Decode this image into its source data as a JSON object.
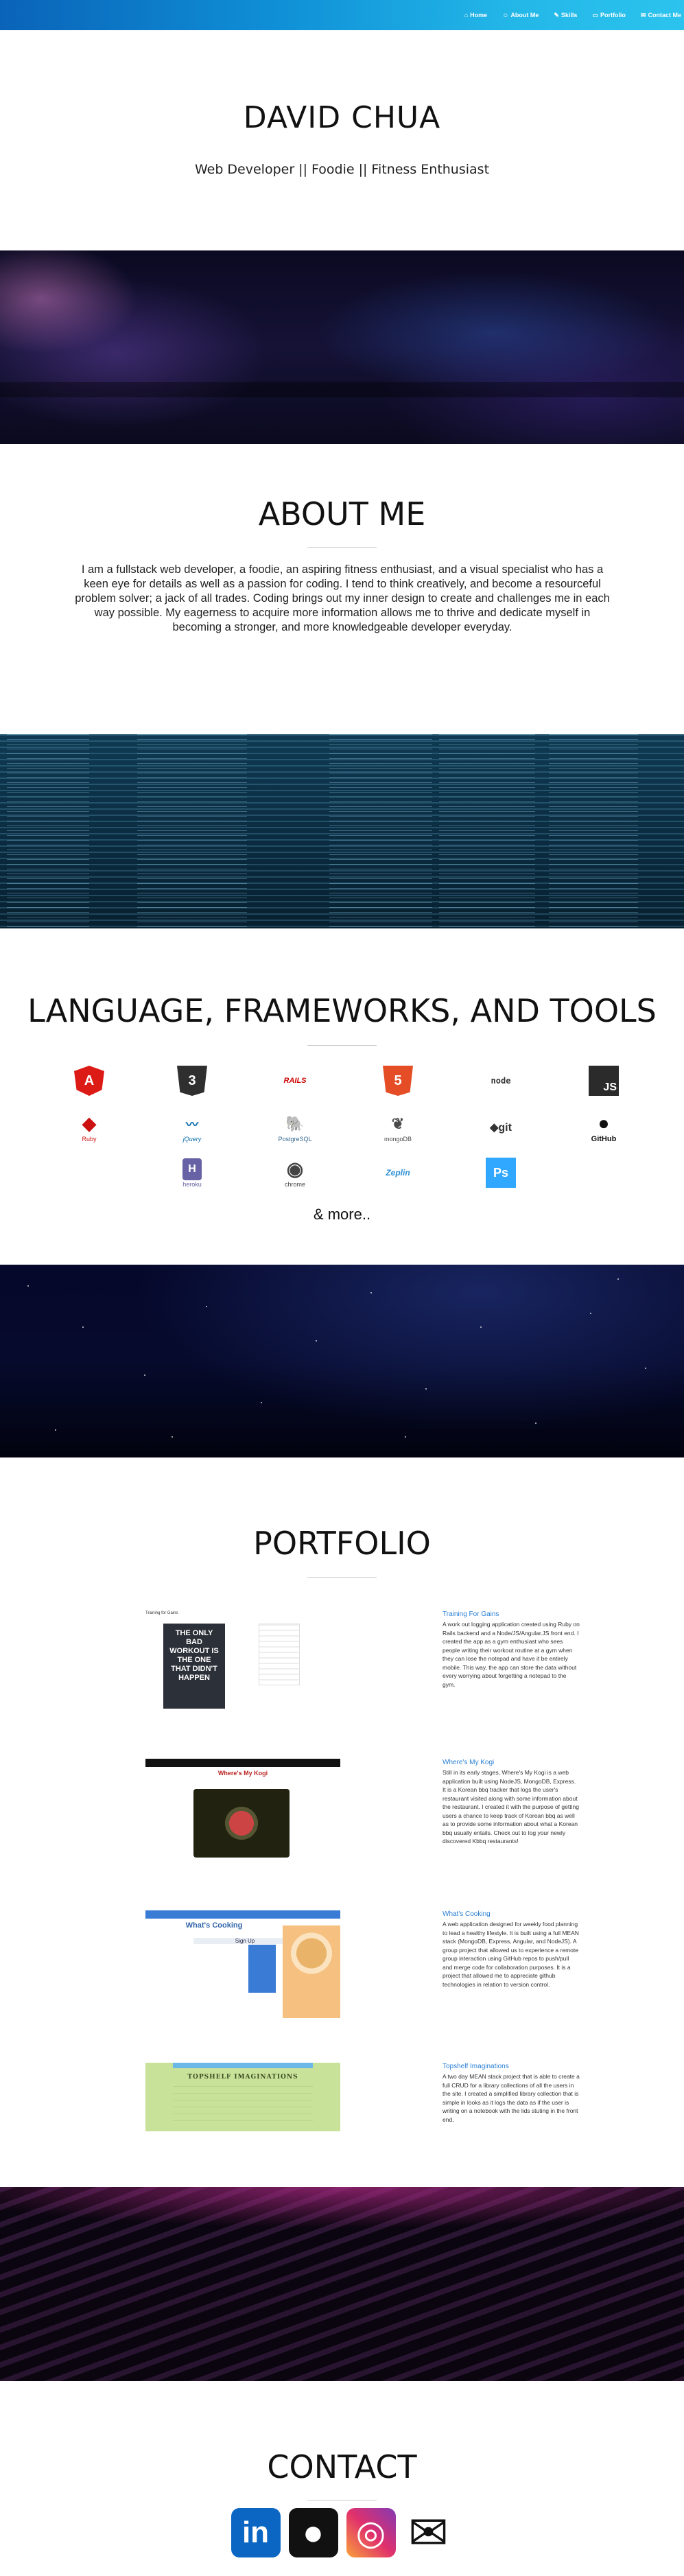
{
  "nav": {
    "items": [
      {
        "icon": "home-icon",
        "label": "Home"
      },
      {
        "icon": "user-icon",
        "label": "About Me"
      },
      {
        "icon": "wrench-icon",
        "label": "Skills"
      },
      {
        "icon": "folder-icon",
        "label": "Portfolio"
      },
      {
        "icon": "envelope-icon",
        "label": "Contact Me"
      }
    ]
  },
  "header": {
    "name": "DAVID CHUA",
    "tagline": "Web Developer || Foodie || Fitness Enthusiast"
  },
  "about": {
    "title": "ABOUT ME",
    "body": "I am a fullstack web developer, a foodie, an aspiring fitness enthusiast, and a visual specialist who has a keen eye for details as well as a passion for coding. I tend to think creatively, and become a resourceful problem solver; a jack of all trades. Coding brings out my inner design to create and challenges me in each way possible. My eagerness to acquire more information allows me to thrive and dedicate myself in becoming a stronger, and more knowledgeable developer everyday."
  },
  "skills": {
    "title": "LANGUAGE, FRAMEWORKS, AND TOOLS",
    "more": "& more..",
    "items": [
      {
        "name": "angular-logo",
        "glyph": "A",
        "caption": "",
        "color": "#dd1b16"
      },
      {
        "name": "css3-logo",
        "glyph": "3",
        "caption": "",
        "color": "#2f2f2f"
      },
      {
        "name": "rails-logo",
        "glyph": "RAILS",
        "caption": "",
        "color": "#cc0000"
      },
      {
        "name": "html5-logo",
        "glyph": "5",
        "caption": "",
        "color": "#e44d26"
      },
      {
        "name": "nodejs-logo",
        "glyph": "node",
        "caption": "",
        "color": "#333333"
      },
      {
        "name": "js-logo",
        "glyph": "JS",
        "caption": "",
        "color": "#2b2b2b"
      },
      {
        "name": "ruby-logo",
        "glyph": "◆",
        "caption": "Ruby",
        "color": "#cc1111"
      },
      {
        "name": "jquery-logo",
        "glyph": "〰",
        "caption": "jQuery",
        "color": "#0769ad"
      },
      {
        "name": "postgresql-logo",
        "glyph": "🐘",
        "caption": "PostgreSQL",
        "color": "#336791"
      },
      {
        "name": "mongodb-logo",
        "glyph": "❦",
        "caption": "mongoDB",
        "color": "#4a4a4a"
      },
      {
        "name": "git-logo",
        "glyph": "◆git",
        "caption": "",
        "color": "#333333"
      },
      {
        "name": "github-logo",
        "glyph": "●",
        "caption": "GitHub",
        "color": "#111111"
      },
      {
        "name": "heroku-logo",
        "glyph": "H",
        "caption": "heroku",
        "color": "#6762a6"
      },
      {
        "name": "chrome-logo",
        "glyph": "◉",
        "caption": "chrome",
        "color": "#444444"
      },
      {
        "name": "netlify-logo",
        "glyph": "Zeplin",
        "caption": "",
        "color": "#2d8fd5"
      },
      {
        "name": "photoshop-logo",
        "glyph": "Ps",
        "caption": "",
        "color": "#31a8ff"
      }
    ]
  },
  "portfolio": {
    "title": "PORTFOLIO",
    "projects": [
      {
        "title": "Training For Gains",
        "desc": "A work out logging application created using Ruby on Rails backend and a Node/JS/Angular.JS front end. I created the app as a gym enthusiast who sees people writing their workout routine at a gym when they can lose the notepad and have it be entirely mobile. This way, the app can store the data without every worrying about forgetting a notepad to the gym.",
        "thumb_text": "THE ONLY BAD WORKOUT IS THE ONE THAT DIDN'T HAPPEN",
        "thumb_header": "Training for Gains"
      },
      {
        "title": "Where's My Kogi",
        "desc": "Still in its early stages, Where's My Kogi is a web application built using NodeJS, MongoDB, Express. It is a Korean bbq tracker that logs the user's restaurant visited along with some information about the restaurant. I created it with the purpose of getting users a chance to keep track of Korean bbq as well as to provide some information about what a Korean bbq usually entails. Check out to log your newly discovered Kbbq restaurants!",
        "thumb_text": "Where's My Kogi",
        "thumb_header": ""
      },
      {
        "title": "What's Cooking",
        "desc": "A web application designed for weekly food planning to lead a healthy lifestyle. It is built using a full MEAN stack (MongoDB, Express, Angular, and NodeJS). A group project that allowed us to experience a remote group interaction using GitHub repos to push/pull and merge code for collaboration purposes. It is a project that allowed me to appreciate github technologies in relation to version control.",
        "thumb_text": "What's Cooking",
        "thumb_header": "Sign Up"
      },
      {
        "title": "Topshelf Imaginations",
        "desc": "A two day MEAN stack project that is able to create a full CRUD for a library collections of all the users in the site. I created a simplified library collection that is simple in looks as it logs the data as if the user is writing on a notebook with the lids stuting in the front end.",
        "thumb_text": "TOPSHELF IMAGINATIONS",
        "thumb_header": ""
      }
    ]
  },
  "contact": {
    "title": "CONTACT",
    "links": [
      {
        "name": "linkedin-icon",
        "glyph": "in",
        "color": "#0a66c2"
      },
      {
        "name": "github-icon",
        "glyph": "●",
        "color": "#111111"
      },
      {
        "name": "instagram-icon",
        "glyph": "◎",
        "color": "#c13584"
      },
      {
        "name": "email-icon",
        "glyph": "✉",
        "color": "#111111"
      }
    ]
  }
}
